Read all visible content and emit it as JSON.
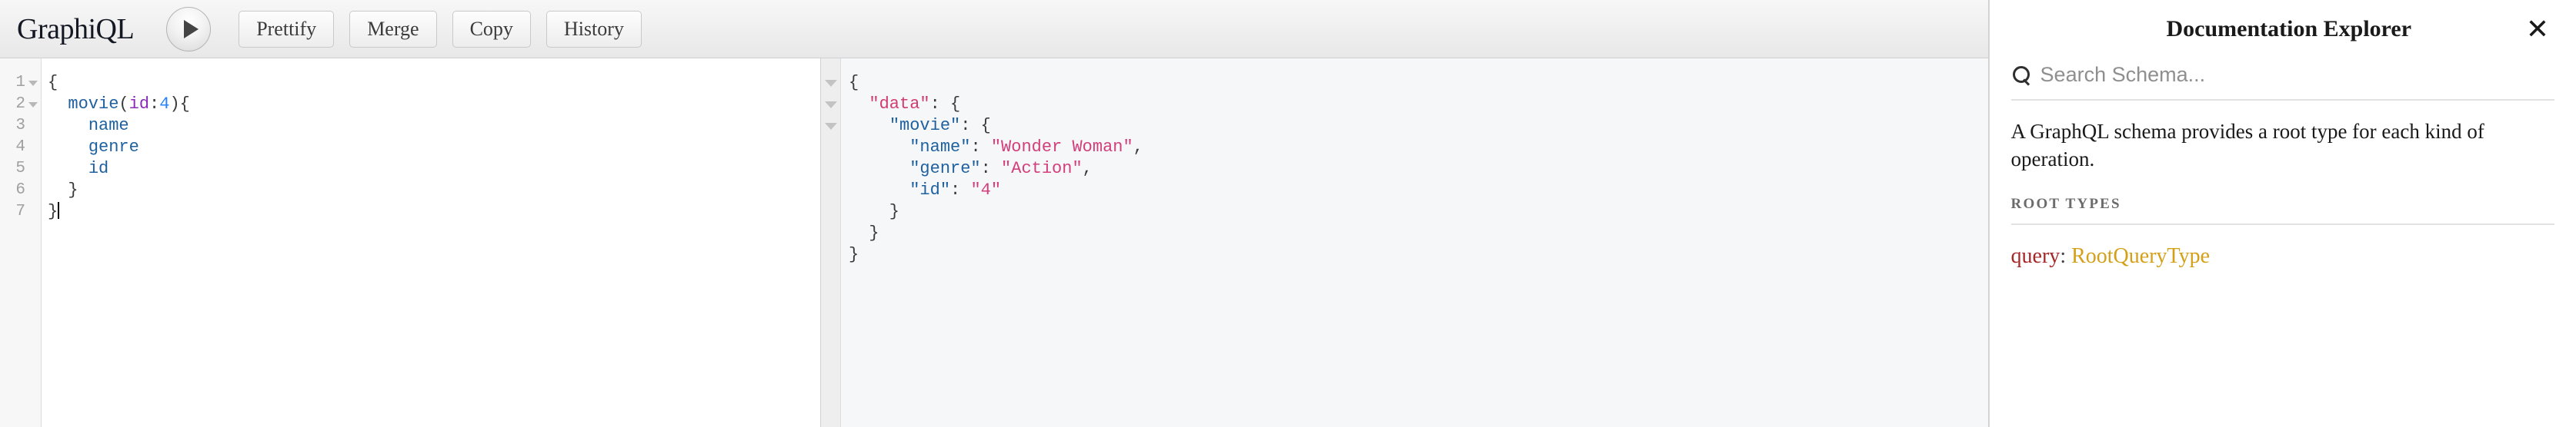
{
  "toolbar": {
    "logo": "GraphiQL",
    "execute_icon": "play-icon",
    "buttons": [
      {
        "label": "Prettify",
        "name": "prettify-button"
      },
      {
        "label": "Merge",
        "name": "merge-button"
      },
      {
        "label": "Copy",
        "name": "copy-button"
      },
      {
        "label": "History",
        "name": "history-button"
      }
    ]
  },
  "query_editor": {
    "lines": [
      {
        "number": "1",
        "foldable": true,
        "tokens": [
          {
            "t": "{",
            "c": "tk-punct"
          }
        ]
      },
      {
        "number": "2",
        "foldable": true,
        "tokens": [
          {
            "t": "  ",
            "c": "tk-punct"
          },
          {
            "t": "movie",
            "c": "tk-field"
          },
          {
            "t": "(",
            "c": "tk-punct"
          },
          {
            "t": "id",
            "c": "tk-arg"
          },
          {
            "t": ":",
            "c": "tk-punct"
          },
          {
            "t": "4",
            "c": "tk-num"
          },
          {
            "t": ")",
            "c": "tk-punct"
          },
          {
            "t": "{",
            "c": "tk-punct"
          }
        ]
      },
      {
        "number": "3",
        "foldable": false,
        "tokens": [
          {
            "t": "    ",
            "c": "tk-punct"
          },
          {
            "t": "name",
            "c": "tk-field"
          }
        ]
      },
      {
        "number": "4",
        "foldable": false,
        "tokens": [
          {
            "t": "    ",
            "c": "tk-punct"
          },
          {
            "t": "genre",
            "c": "tk-field"
          }
        ]
      },
      {
        "number": "5",
        "foldable": false,
        "tokens": [
          {
            "t": "    ",
            "c": "tk-punct"
          },
          {
            "t": "id",
            "c": "tk-field"
          }
        ]
      },
      {
        "number": "6",
        "foldable": false,
        "tokens": [
          {
            "t": "  }",
            "c": "tk-punct"
          }
        ]
      },
      {
        "number": "7",
        "foldable": false,
        "tokens": [
          {
            "t": "}",
            "c": "tk-punct"
          }
        ],
        "cursor": true
      }
    ]
  },
  "result_viewer": {
    "lines": [
      {
        "foldable": true,
        "tokens": [
          {
            "t": "{",
            "c": "rk-p"
          }
        ]
      },
      {
        "foldable": true,
        "tokens": [
          {
            "t": "  ",
            "c": "rk-p"
          },
          {
            "t": "\"data\"",
            "c": "rk-meta"
          },
          {
            "t": ": {",
            "c": "rk-p"
          }
        ]
      },
      {
        "foldable": true,
        "tokens": [
          {
            "t": "    ",
            "c": "rk-p"
          },
          {
            "t": "\"movie\"",
            "c": "rk-key"
          },
          {
            "t": ": {",
            "c": "rk-p"
          }
        ]
      },
      {
        "foldable": false,
        "tokens": [
          {
            "t": "      ",
            "c": "rk-p"
          },
          {
            "t": "\"name\"",
            "c": "rk-key"
          },
          {
            "t": ": ",
            "c": "rk-p"
          },
          {
            "t": "\"Wonder Woman\"",
            "c": "rk-str"
          },
          {
            "t": ",",
            "c": "rk-p"
          }
        ]
      },
      {
        "foldable": false,
        "tokens": [
          {
            "t": "      ",
            "c": "rk-p"
          },
          {
            "t": "\"genre\"",
            "c": "rk-key"
          },
          {
            "t": ": ",
            "c": "rk-p"
          },
          {
            "t": "\"Action\"",
            "c": "rk-str"
          },
          {
            "t": ",",
            "c": "rk-p"
          }
        ]
      },
      {
        "foldable": false,
        "tokens": [
          {
            "t": "      ",
            "c": "rk-p"
          },
          {
            "t": "\"id\"",
            "c": "rk-key"
          },
          {
            "t": ": ",
            "c": "rk-p"
          },
          {
            "t": "\"4\"",
            "c": "rk-str"
          }
        ]
      },
      {
        "foldable": false,
        "tokens": [
          {
            "t": "    }",
            "c": "rk-p"
          }
        ]
      },
      {
        "foldable": false,
        "tokens": [
          {
            "t": "  }",
            "c": "rk-p"
          }
        ]
      },
      {
        "foldable": false,
        "tokens": [
          {
            "t": "}",
            "c": "rk-p"
          }
        ]
      }
    ]
  },
  "doc_explorer": {
    "title": "Documentation Explorer",
    "close_icon": "close-icon",
    "search": {
      "icon": "search-icon",
      "placeholder": "Search Schema..."
    },
    "description": "A GraphQL schema provides a root type for each kind of operation.",
    "section_label": "ROOT TYPES",
    "root_types": [
      {
        "field": "query",
        "separator": ":",
        "type": "RootQueryType"
      }
    ]
  },
  "colors": {
    "field": "#1f61a0",
    "argument": "#8b2bb9",
    "number": "#2882f9",
    "string": "#d23f7c",
    "meta": "#d03d6e",
    "root_field": "#a52727",
    "root_type": "#d4a017"
  }
}
